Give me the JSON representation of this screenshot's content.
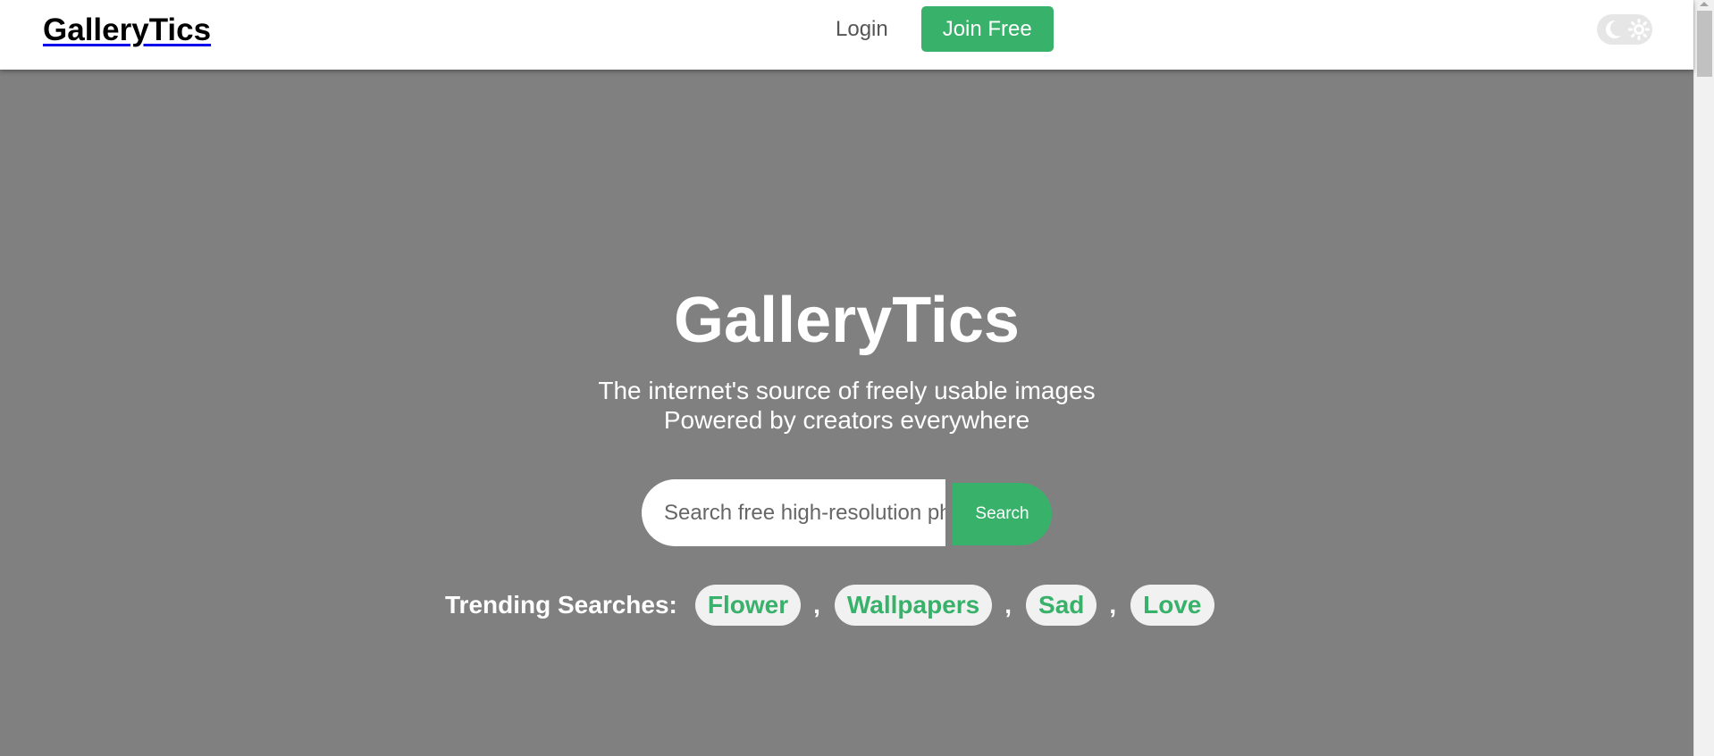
{
  "navbar": {
    "logo": "GalleryTics",
    "login_label": "Login",
    "join_label": "Join Free",
    "theme_toggle_icons": [
      "moon-icon",
      "sun-icon"
    ]
  },
  "hero": {
    "title": "GalleryTics",
    "tagline_line1": "The internet's source of freely usable images",
    "tagline_line2": "Powered by creators everywhere",
    "search_placeholder": "Search free high-resolution photos",
    "search_button": "Search",
    "trending_label": "Trending Searches:",
    "trending": [
      "Flower",
      "Wallpapers",
      "Sad",
      "Love"
    ],
    "separator": ","
  },
  "colors": {
    "accent": "#38b16a",
    "hero_background": "#808080",
    "navbar_background": "#ffffff",
    "chip_background": "#f1f1f1"
  }
}
